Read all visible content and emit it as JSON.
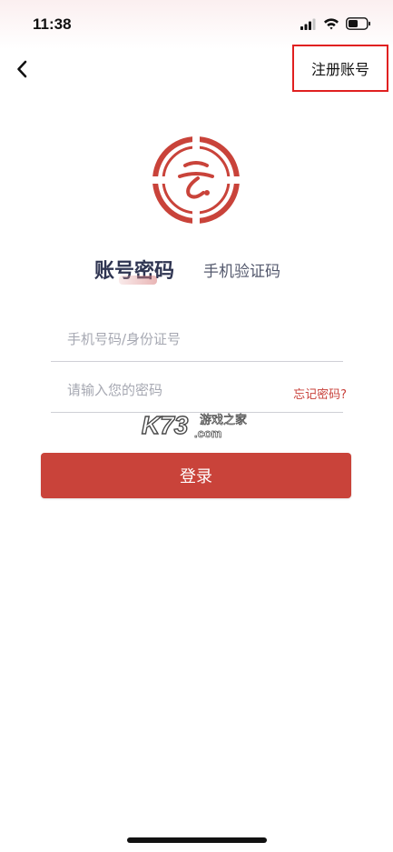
{
  "status_bar": {
    "time": "11:38",
    "icons": [
      "signal-icon",
      "wifi-icon",
      "battery-icon"
    ]
  },
  "nav": {
    "back_icon": "chevron-left-icon",
    "register_label": "注册账号"
  },
  "logo": {
    "icon": "brand-logo-icon",
    "color": "#c9433a"
  },
  "tabs": [
    {
      "label": "账号密码",
      "active": true
    },
    {
      "label": "手机验证码",
      "active": false
    }
  ],
  "form": {
    "phone_placeholder": "手机号码/身份证号",
    "password_placeholder": "请输入您的密码",
    "forgot_label": "忘记密码?",
    "login_label": "登录"
  },
  "watermark": {
    "brand": "K73",
    "text": "游戏之家",
    "domain": ".com"
  },
  "colors": {
    "accent": "#c9433a",
    "highlight_border": "#e02020",
    "tab_active": "#2f3552"
  }
}
